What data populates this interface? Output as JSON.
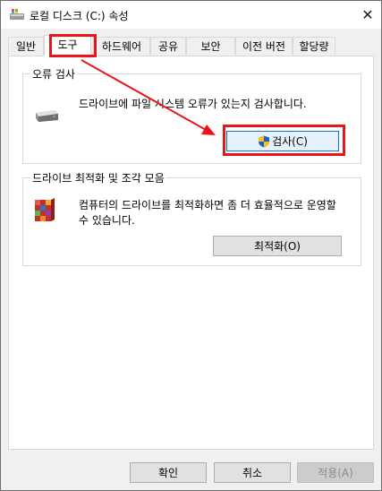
{
  "window": {
    "title": "로컬 디스크 (C:) 속성",
    "close_glyph": "✕"
  },
  "tabs": [
    {
      "label": "일반"
    },
    {
      "label": "도구"
    },
    {
      "label": "하드웨어"
    },
    {
      "label": "공유"
    },
    {
      "label": "보안"
    },
    {
      "label": "이전 버전"
    },
    {
      "label": "할당량"
    }
  ],
  "active_tab": "도구",
  "error_check": {
    "title": "오류 검사",
    "description": "드라이브에 파일 시스템 오류가 있는지 검사합니다.",
    "button_label": "검사(C)",
    "icon": "drive-icon"
  },
  "optimize": {
    "title": "드라이브 최적화 및 조각 모음",
    "description": "컴퓨터의 드라이브를 최적화하면 좀 더 효율적으로 운영할 수 있습니다.",
    "button_label": "최적화(O)",
    "icon": "defrag-icon"
  },
  "footer": {
    "ok_label": "확인",
    "cancel_label": "취소",
    "apply_label": "적용(A)"
  },
  "colors": {
    "annotation_red": "#e8161b",
    "focus_blue": "#0078d7",
    "panel_bg": "#ffffff",
    "window_bg": "#f0f0f0"
  }
}
